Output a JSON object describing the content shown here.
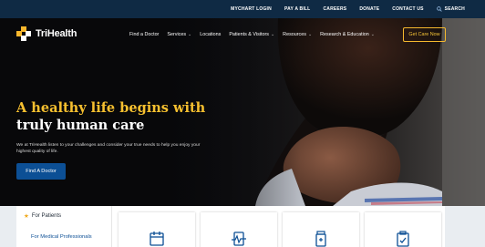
{
  "utility_bar": {
    "links": [
      "MYCHART LOGIN",
      "PAY A BILL",
      "CAREERS",
      "DONATE",
      "CONTACT US"
    ],
    "search_label": "SEARCH",
    "search_icon": "search-icon"
  },
  "brand": {
    "name": "TriHealth",
    "logo_icon": "trihealth-logo-icon"
  },
  "nav": {
    "items": [
      {
        "label": "Find a Doctor",
        "has_menu": false
      },
      {
        "label": "Services",
        "has_menu": true
      },
      {
        "label": "Locations",
        "has_menu": false
      },
      {
        "label": "Patients & Visitors",
        "has_menu": true
      },
      {
        "label": "Resources",
        "has_menu": true
      },
      {
        "label": "Research & Education",
        "has_menu": true
      }
    ],
    "cta_label": "Get Care Now"
  },
  "hero": {
    "headline_line1": "A healthy life begins with",
    "headline_line2": "truly human care",
    "intro": "We at TriHealth listen to your challenges and consider your true needs to help you enjoy your highest quality of life.",
    "button_label": "Find A Doctor"
  },
  "audience": {
    "tabs": [
      "For Patients",
      "For Medical Professionals"
    ],
    "selected": "For Patients"
  },
  "cards": [
    {
      "icon": "calendar-icon"
    },
    {
      "icon": "heart-monitor-icon"
    },
    {
      "icon": "medicine-bottle-icon"
    },
    {
      "icon": "clipboard-check-icon"
    }
  ],
  "colors": {
    "utility_bar": "#0f2a44",
    "accent_gold": "#f7c02f",
    "primary_blue": "#0c4f95",
    "hero_background": "#0b0c10"
  }
}
